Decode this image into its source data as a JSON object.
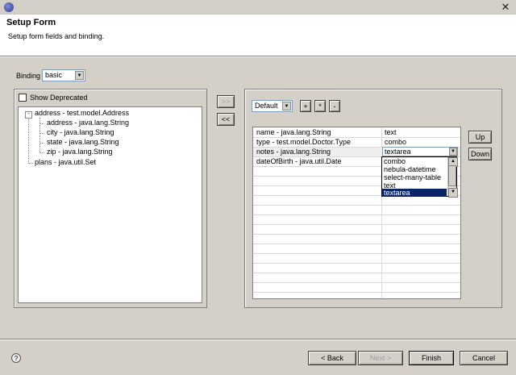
{
  "header": {
    "title": "Setup Form",
    "description": "Setup form fields and binding."
  },
  "binding": {
    "label": "Binding",
    "value": "basic"
  },
  "show_deprecated": {
    "label": "Show Deprecated",
    "checked": false
  },
  "tree": [
    {
      "label": "address - test.model.Address",
      "level": 0,
      "expander": "-"
    },
    {
      "label": "address - java.lang.String",
      "level": 1
    },
    {
      "label": "city - java.lang.String",
      "level": 1
    },
    {
      "label": "state - java.lang.String",
      "level": 1
    },
    {
      "label": "zip - java.lang.String",
      "level": 1
    },
    {
      "label": "plans - java.util.Set",
      "level": 0
    }
  ],
  "transfer": {
    "add": ">>",
    "remove": "<<"
  },
  "layout_combo": {
    "value": "Default"
  },
  "tool_buttons": {
    "add": "+",
    "star": "*",
    "remove": "-"
  },
  "fields": [
    {
      "field": "name - java.lang.String",
      "widget": "text"
    },
    {
      "field": "type - test.model.Doctor.Type",
      "widget": "combo"
    },
    {
      "field": "notes - java.lang.String",
      "widget": "textarea"
    },
    {
      "field": "dateOfBirth - java.util.Date",
      "widget": ""
    }
  ],
  "widget_options": [
    "combo",
    "nebula-datetime",
    "select-many-table",
    "text",
    "textarea"
  ],
  "widget_selected": "textarea",
  "order": {
    "up": "Up",
    "down": "Down"
  },
  "footer": {
    "help": "?",
    "back": "< Back",
    "next": "Next >",
    "finish": "Finish",
    "cancel": "Cancel"
  },
  "icons": {
    "app": "eclipse-icon",
    "close": "close-icon"
  }
}
